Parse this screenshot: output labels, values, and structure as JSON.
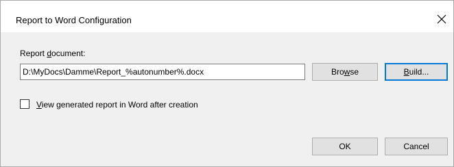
{
  "window": {
    "title": "Report to Word Configuration",
    "close_icon": "close-icon"
  },
  "form": {
    "doc_label_pre": "Report ",
    "doc_label_accel": "d",
    "doc_label_post": "ocument:",
    "path_value": "D:\\MyDocs\\Damme\\Report_%autonumber%.docx",
    "browse_pre": "Bro",
    "browse_accel": "w",
    "browse_post": "se",
    "build_accel": "B",
    "build_post": "uild...",
    "checkbox_checked": false,
    "checkbox_accel": "V",
    "checkbox_post": "iew generated report in Word after creation"
  },
  "footer": {
    "ok_label": "OK",
    "cancel_label": "Cancel"
  },
  "colors": {
    "default_button_border": "#0078d7",
    "dialog_background": "#f0f0f0",
    "titlebar_background": "#ffffff"
  }
}
